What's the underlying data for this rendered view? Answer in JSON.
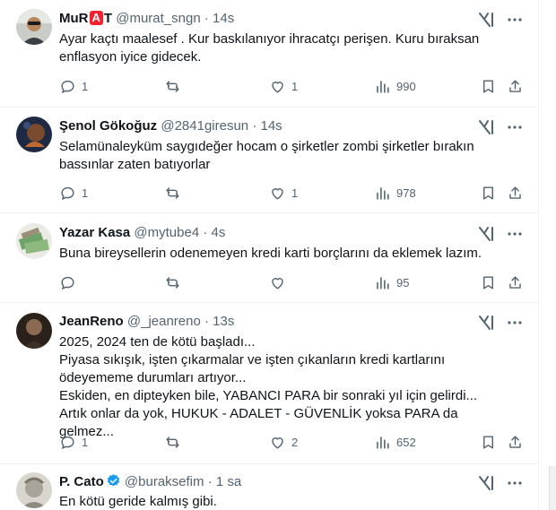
{
  "tweets": [
    {
      "name_prefix": "MuR",
      "name_logo": "A",
      "name_suffix": "T",
      "handle": "@murat_sngn",
      "sep": "·",
      "time": "14s",
      "lines": [
        "Ayar kaçtı maalesef . Kur baskılanıyor ihracatçı perişen. Kuru bıraksan",
        "enflasyon iyice gidecek."
      ],
      "reply_count": "1",
      "retweet_count": "",
      "like_count": "1",
      "view_count": "990"
    },
    {
      "name": "Şenol Gökoğuz",
      "handle": "@2841giresun",
      "sep": "·",
      "time": "14s",
      "lines": [
        "Selamünaleyküm saygıdeğer hocam o şirketler zombi şirketler bırakın",
        "bassınlar zaten batıyorlar"
      ],
      "reply_count": "1",
      "retweet_count": "",
      "like_count": "1",
      "view_count": "978"
    },
    {
      "name": "Yazar Kasa",
      "handle": "@mytube4",
      "sep": "·",
      "time": "4s",
      "lines": [
        "Buna bireysellerin odenemeyen kredi karti borçlarını da eklemek lazım."
      ],
      "reply_count": "",
      "retweet_count": "",
      "like_count": "",
      "view_count": "95"
    },
    {
      "name": "JeanReno",
      "handle": "@_jeanreno",
      "sep": "·",
      "time": "13s",
      "lines": [
        "2025, 2024 ten de kötü başladı...",
        "Piyasa sıkışık,  işten çıkarmalar ve işten çıkanların kredi kartlarını",
        "ödeyememe durumları artıyor...",
        "Eskiden, en dipteyken bile, YABANCI PARA bir sonraki yıl için gelirdi...",
        "Artık onlar da yok, HUKUK - ADALET - GÜVENLİK yoksa PARA da gelmez..."
      ],
      "reply_count": "1",
      "retweet_count": "",
      "like_count": "2",
      "view_count": "652"
    },
    {
      "name": "P. Cato",
      "handle": "@buraksefim",
      "sep": "·",
      "time": "1 sa",
      "lines": [
        "En kötü geride kalmış gibi."
      ]
    }
  ],
  "icons": {
    "reply": "reply-icon",
    "retweet": "retweet-icon",
    "like": "like-icon",
    "views": "views-icon",
    "bookmark": "bookmark-icon",
    "share": "share-icon",
    "grok": "grok-icon",
    "more": "more-icon",
    "verified": "verified-badge-icon"
  },
  "colors": {
    "text": "#0f1419",
    "muted": "#536471",
    "divider": "#eff3f4",
    "verified": "#1d9bf0",
    "logo_red": "#f4212e"
  }
}
